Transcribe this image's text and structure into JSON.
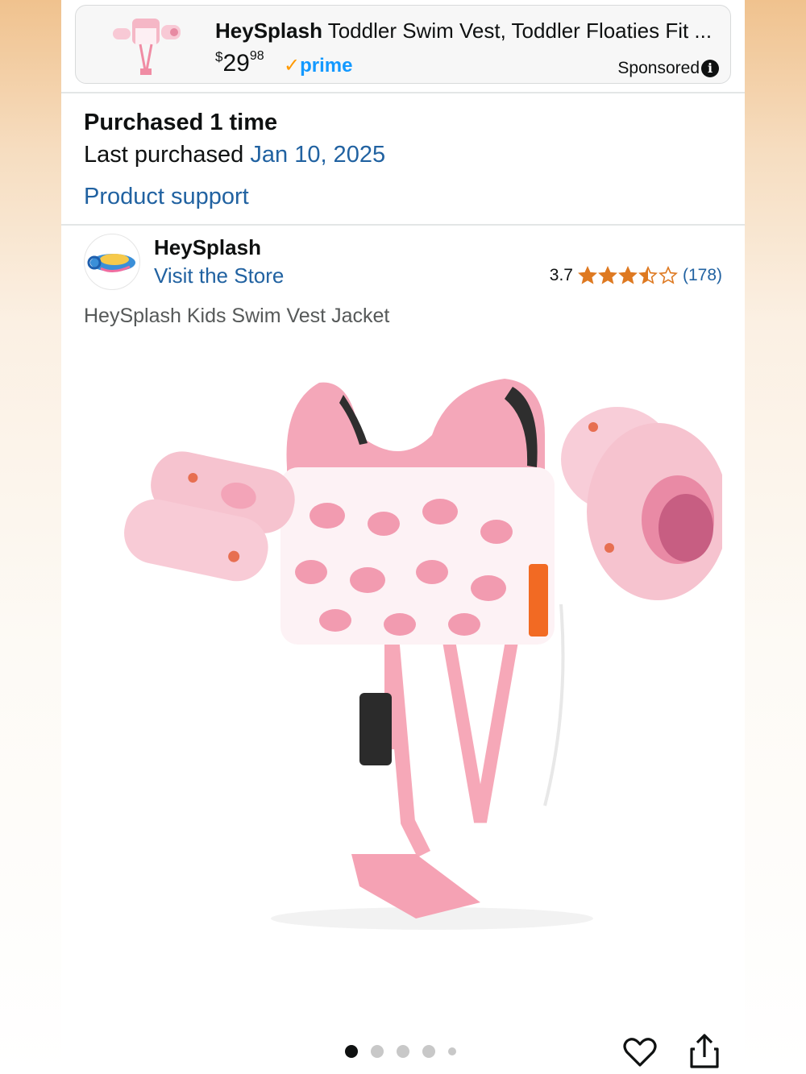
{
  "sponsored_ad": {
    "brand": "HeySplash",
    "title": "Toddler Swim Vest, Toddler Floaties Fit ...",
    "price_symbol": "$",
    "price_whole": "29",
    "price_fraction": "98",
    "prime_check": "✓",
    "prime_label": "prime",
    "sponsored_label": "Sponsored",
    "info_icon": "i"
  },
  "purchase": {
    "count_text": "Purchased 1 time",
    "last_purchased_label": "Last purchased",
    "last_purchased_date": "Jan 10, 2025",
    "support_link": "Product support"
  },
  "store": {
    "name": "HeySplash",
    "visit_link": "Visit the Store",
    "rating": "3.7",
    "stars_filled": 3.5,
    "rating_count": "(178)"
  },
  "product": {
    "title": "HeySplash Kids Swim Vest Jacket",
    "image_count": 5,
    "current_image": 1
  },
  "colors": {
    "link": "#2162a1",
    "star": "#de7921",
    "prime_blue": "#1399ff",
    "prime_check": "#ff9900"
  }
}
